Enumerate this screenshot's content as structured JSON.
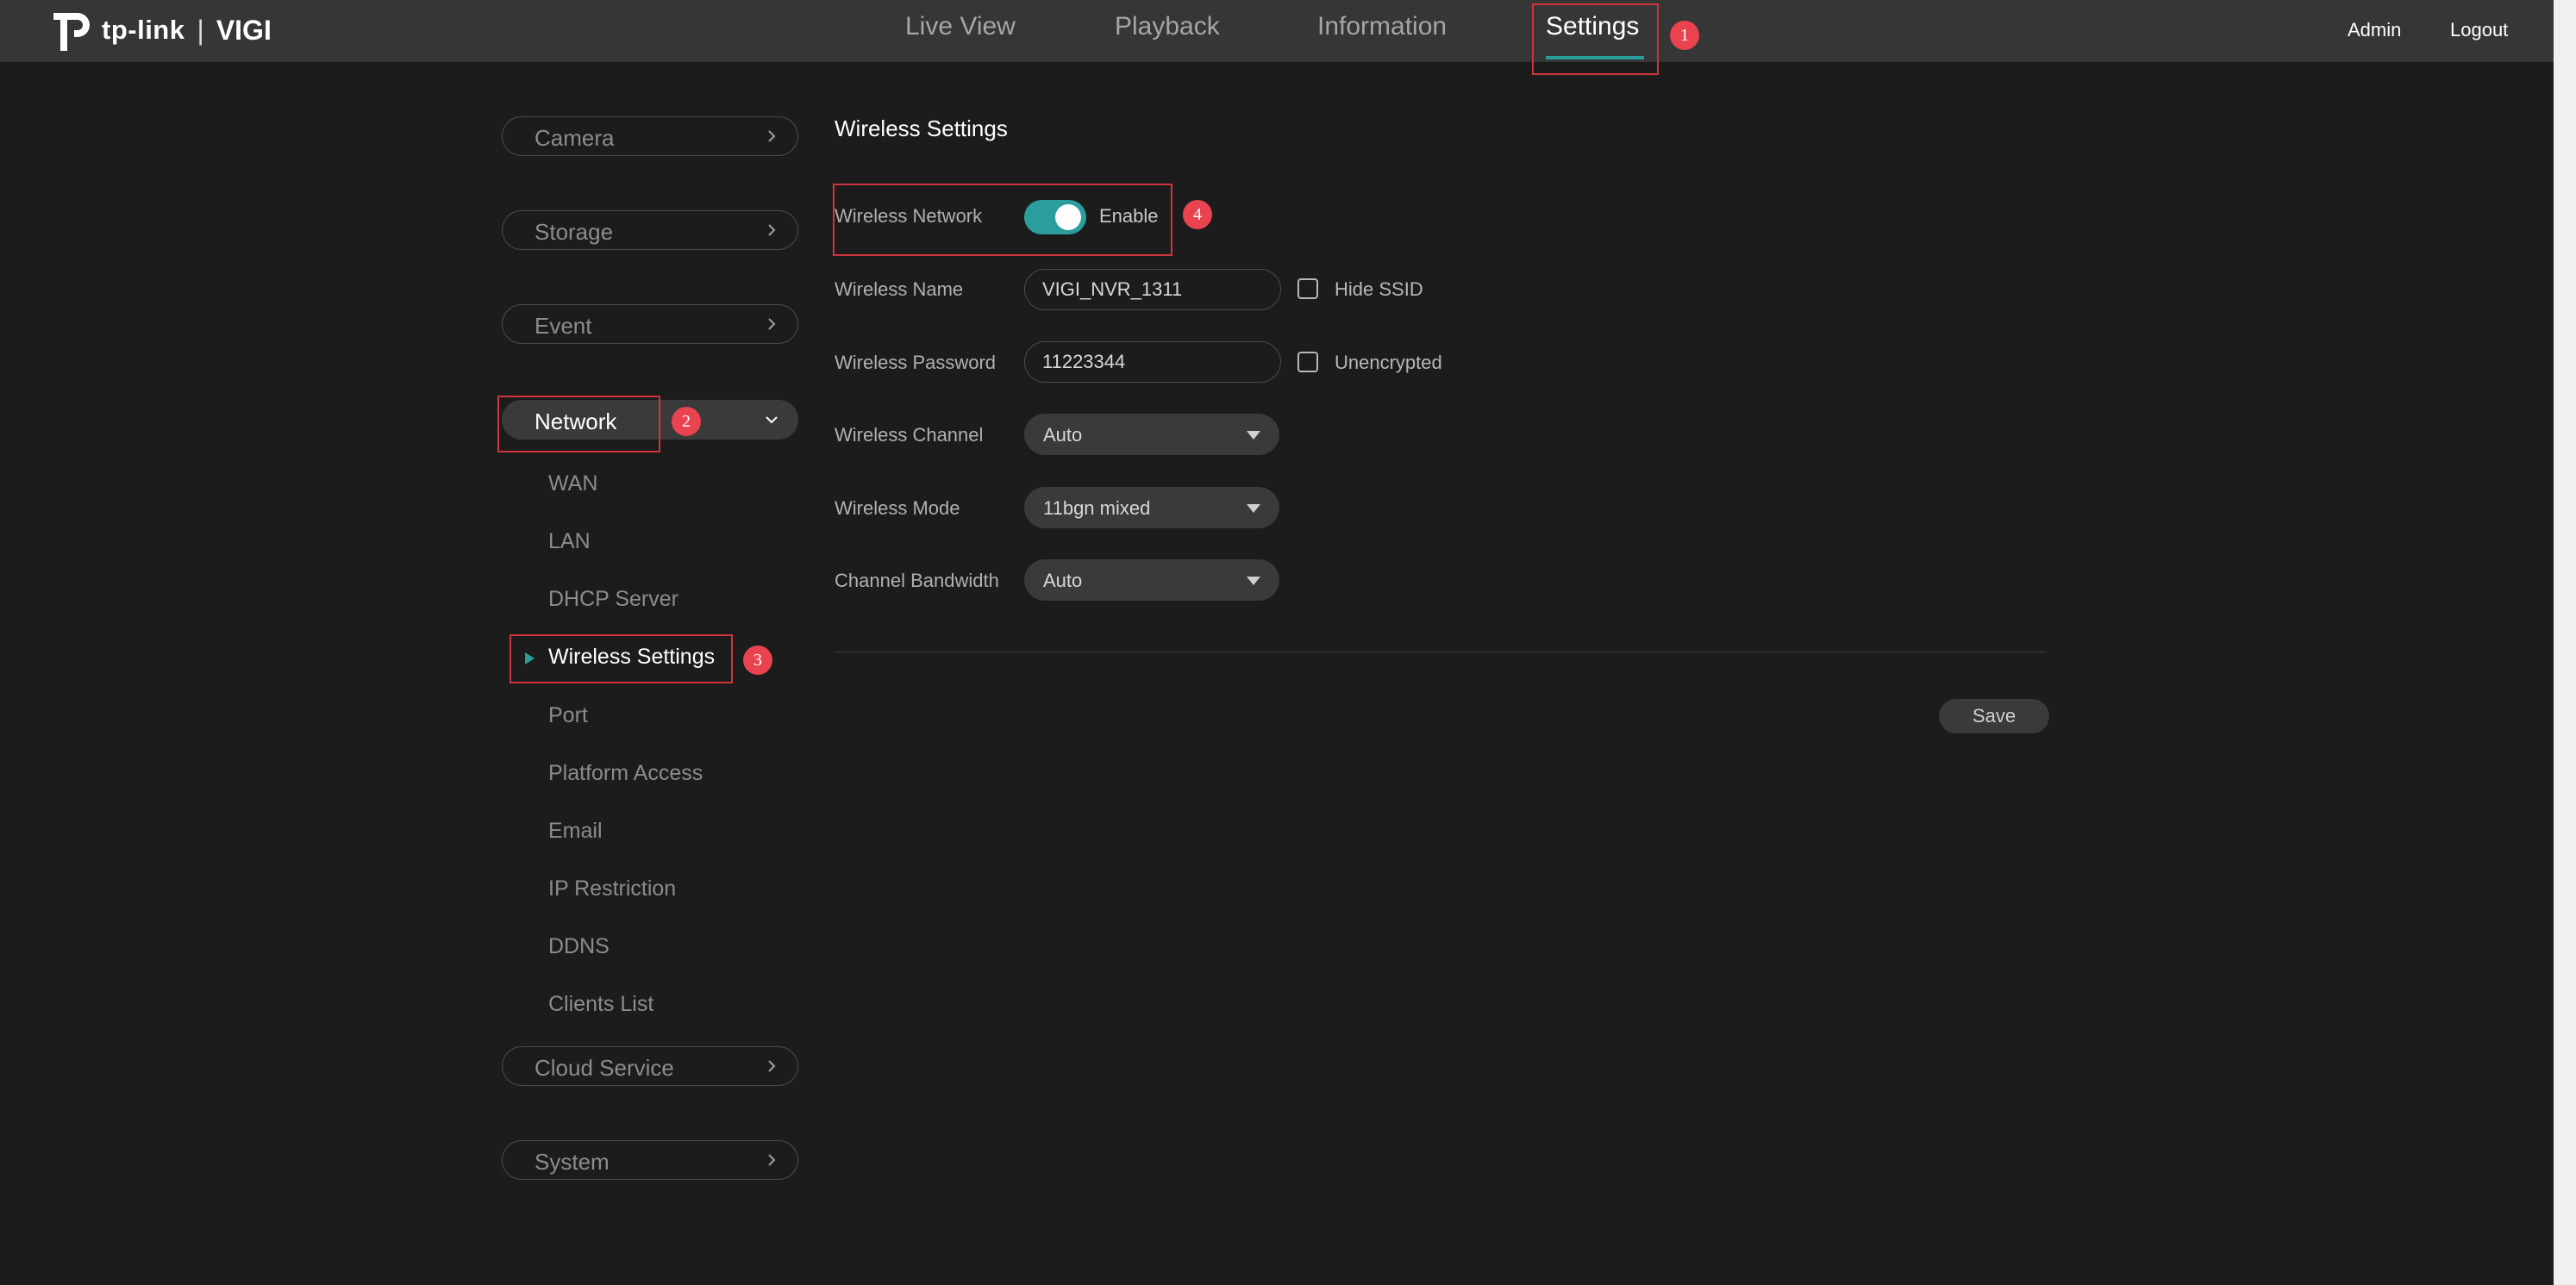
{
  "header": {
    "logo_text": "tp-link",
    "logo_divider": "|",
    "logo_product": "VIGI",
    "nav": [
      "Live View",
      "Playback",
      "Information",
      "Settings"
    ],
    "active_nav": "Settings",
    "user": "Admin",
    "logout": "Logout"
  },
  "sidebar": {
    "camera": "Camera",
    "storage": "Storage",
    "event": "Event",
    "network": "Network",
    "network_items": [
      "WAN",
      "LAN",
      "DHCP Server",
      "Wireless Settings",
      "Port",
      "Platform Access",
      "Email",
      "IP Restriction",
      "DDNS",
      "Clients List"
    ],
    "active_item": "Wireless Settings",
    "cloud_service": "Cloud Service",
    "system": "System"
  },
  "annotations": [
    "1",
    "2",
    "3",
    "4"
  ],
  "content": {
    "title": "Wireless Settings",
    "wireless_network": {
      "label": "Wireless Network",
      "state": "Enable",
      "enabled": true
    },
    "wireless_name": {
      "label": "Wireless Name",
      "value": "VIGI_NVR_1311",
      "checkbox_label": "Hide SSID",
      "checked": false
    },
    "wireless_password": {
      "label": "Wireless Password",
      "value": "11223344",
      "checkbox_label": "Unencrypted",
      "checked": false
    },
    "wireless_channel": {
      "label": "Wireless Channel",
      "value": "Auto"
    },
    "wireless_mode": {
      "label": "Wireless Mode",
      "value": "11bgn mixed"
    },
    "channel_bandwidth": {
      "label": "Channel Bandwidth",
      "value": "Auto"
    },
    "save": "Save"
  },
  "colors": {
    "accent": "#2a9d9d",
    "annotation": "#e8434f",
    "background": "#1c1c1c",
    "topbar": "#363636"
  },
  "icons": [
    "tp-link-logo-icon",
    "chevron-right-icon",
    "chevron-down-icon",
    "caret-down-icon",
    "triangle-right-icon"
  ]
}
